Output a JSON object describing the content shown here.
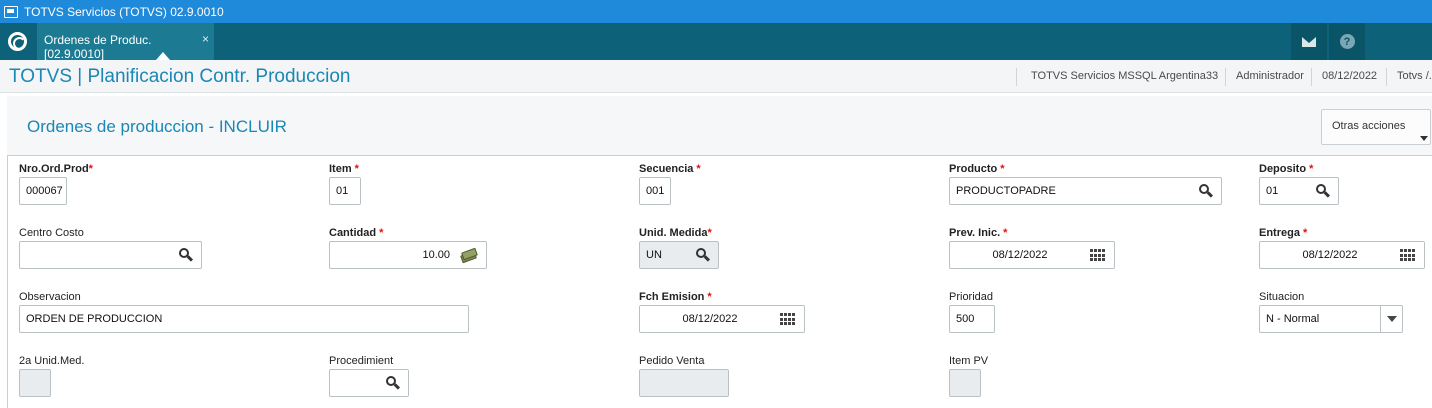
{
  "window": {
    "title": "TOTVS Servicios (TOTVS) 02.9.0010"
  },
  "tabbar": {
    "logo": "totvs-logo-icon",
    "tab_label": "Ordenes de Produc. [02.9.0010]",
    "tab_close": "×",
    "right_icons": [
      "mail-icon",
      "help-icon"
    ],
    "help_glyph": "?"
  },
  "header": {
    "title": "TOTVS | Planificacion Contr. Produccion",
    "environment": "TOTVS Servicios MSSQL Argentina33",
    "user": "Administrador",
    "date": "08/12/2022",
    "company": "Totvs /."
  },
  "section": {
    "title": "Ordenes de produccion - INCLUIR",
    "actions_label": "Otras acciones"
  },
  "form": {
    "nro_ord_prod": {
      "label": "Nro.Ord.Prod",
      "value": "000067",
      "required": "*"
    },
    "item": {
      "label": "Item",
      "value": "01",
      "required": "*"
    },
    "secuencia": {
      "label": "Secuencia",
      "value": "001",
      "required": "*"
    },
    "producto": {
      "label": "Producto",
      "value": "PRODUCTOPADRE",
      "required": "*"
    },
    "deposito": {
      "label": "Deposito",
      "value": "01",
      "required": "*"
    },
    "centro_costo": {
      "label": "Centro Costo",
      "value": ""
    },
    "cantidad": {
      "label": "Cantidad",
      "value": "10.00",
      "required": "*"
    },
    "unid_medida": {
      "label": "Unid. Medida",
      "value": "UN",
      "required": "*"
    },
    "prev_inic": {
      "label": "Prev. Inic.",
      "value": "08/12/2022",
      "required": "*"
    },
    "entrega": {
      "label": "Entrega",
      "value": "08/12/2022",
      "required": "*"
    },
    "observacion": {
      "label": "Observacion",
      "value": "ORDEN DE PRODUCCION"
    },
    "fch_emision": {
      "label": "Fch Emision",
      "value": "08/12/2022",
      "required": "*"
    },
    "prioridad": {
      "label": "Prioridad",
      "value": "500"
    },
    "situacion": {
      "label": "Situacion",
      "value": "N - Normal"
    },
    "segunda_unid": {
      "label": "2a Unid.Med.",
      "value": ""
    },
    "procedimient": {
      "label": "Procedimient",
      "value": ""
    },
    "pedido_venta": {
      "label": "Pedido Venta",
      "value": ""
    },
    "item_pv": {
      "label": "Item PV",
      "value": ""
    }
  },
  "icons": {
    "lookup": "search-icon",
    "calendar": "calendar-icon",
    "calculator": "money-icon",
    "dropdown": "chevron-down-icon"
  }
}
